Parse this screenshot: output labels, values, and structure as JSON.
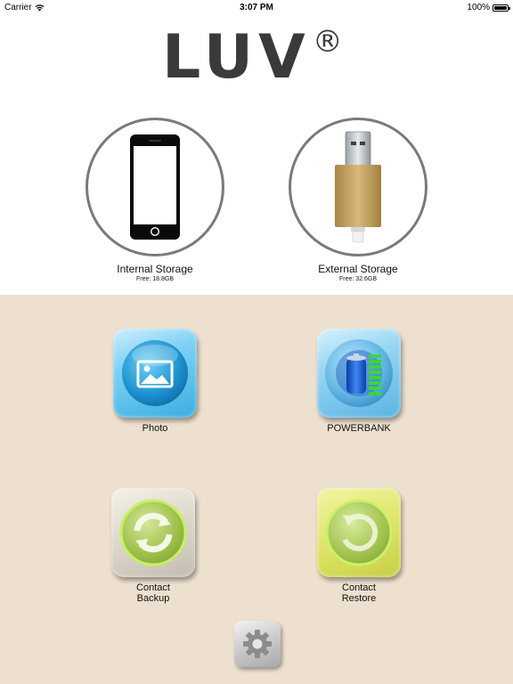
{
  "status_bar": {
    "carrier": "Carrier",
    "time": "3:07 PM",
    "battery": "100%",
    "battery_level": 1.0
  },
  "logo": {
    "text": "LUV",
    "mark": "®"
  },
  "storage": {
    "internal": {
      "label": "Internal Storage",
      "free": "Free: 18.8GB",
      "icon": "smartphone-icon"
    },
    "external": {
      "label": "External Storage",
      "free": "Free: 32.6GB",
      "icon": "usb-drive-icon"
    }
  },
  "tiles": {
    "photo": {
      "label": "Photo",
      "icon": "photo-icon"
    },
    "powerbank": {
      "label": "POWERBANK",
      "icon": "battery-icon"
    },
    "contact_backup": {
      "label_line1": "Contact",
      "label_line2": "Backup",
      "icon": "sync-icon"
    },
    "contact_restore": {
      "label_line1": "Contact",
      "label_line2": "Restore",
      "icon": "restore-icon"
    }
  },
  "settings": {
    "icon": "gear-icon"
  },
  "colors": {
    "panel_bg": "#ede0cf",
    "photo_tile": "#39aee0",
    "powerbank_tile": "#58b4e3",
    "backup_tile": "#dcd7ca",
    "restore_tile": "#dfe568",
    "logo": "#3a3a3a"
  }
}
